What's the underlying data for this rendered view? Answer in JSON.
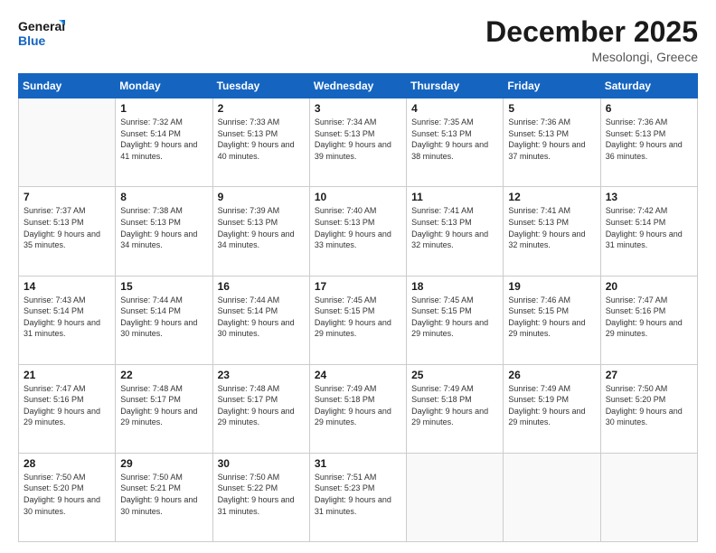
{
  "logo": {
    "line1": "General",
    "line2": "Blue"
  },
  "title": "December 2025",
  "location": "Mesolongi, Greece",
  "weekdays": [
    "Sunday",
    "Monday",
    "Tuesday",
    "Wednesday",
    "Thursday",
    "Friday",
    "Saturday"
  ],
  "weeks": [
    [
      {
        "day": "",
        "sunrise": "",
        "sunset": "",
        "daylight": ""
      },
      {
        "day": "1",
        "sunrise": "Sunrise: 7:32 AM",
        "sunset": "Sunset: 5:14 PM",
        "daylight": "Daylight: 9 hours and 41 minutes."
      },
      {
        "day": "2",
        "sunrise": "Sunrise: 7:33 AM",
        "sunset": "Sunset: 5:13 PM",
        "daylight": "Daylight: 9 hours and 40 minutes."
      },
      {
        "day": "3",
        "sunrise": "Sunrise: 7:34 AM",
        "sunset": "Sunset: 5:13 PM",
        "daylight": "Daylight: 9 hours and 39 minutes."
      },
      {
        "day": "4",
        "sunrise": "Sunrise: 7:35 AM",
        "sunset": "Sunset: 5:13 PM",
        "daylight": "Daylight: 9 hours and 38 minutes."
      },
      {
        "day": "5",
        "sunrise": "Sunrise: 7:36 AM",
        "sunset": "Sunset: 5:13 PM",
        "daylight": "Daylight: 9 hours and 37 minutes."
      },
      {
        "day": "6",
        "sunrise": "Sunrise: 7:36 AM",
        "sunset": "Sunset: 5:13 PM",
        "daylight": "Daylight: 9 hours and 36 minutes."
      }
    ],
    [
      {
        "day": "7",
        "sunrise": "Sunrise: 7:37 AM",
        "sunset": "Sunset: 5:13 PM",
        "daylight": "Daylight: 9 hours and 35 minutes."
      },
      {
        "day": "8",
        "sunrise": "Sunrise: 7:38 AM",
        "sunset": "Sunset: 5:13 PM",
        "daylight": "Daylight: 9 hours and 34 minutes."
      },
      {
        "day": "9",
        "sunrise": "Sunrise: 7:39 AM",
        "sunset": "Sunset: 5:13 PM",
        "daylight": "Daylight: 9 hours and 34 minutes."
      },
      {
        "day": "10",
        "sunrise": "Sunrise: 7:40 AM",
        "sunset": "Sunset: 5:13 PM",
        "daylight": "Daylight: 9 hours and 33 minutes."
      },
      {
        "day": "11",
        "sunrise": "Sunrise: 7:41 AM",
        "sunset": "Sunset: 5:13 PM",
        "daylight": "Daylight: 9 hours and 32 minutes."
      },
      {
        "day": "12",
        "sunrise": "Sunrise: 7:41 AM",
        "sunset": "Sunset: 5:13 PM",
        "daylight": "Daylight: 9 hours and 32 minutes."
      },
      {
        "day": "13",
        "sunrise": "Sunrise: 7:42 AM",
        "sunset": "Sunset: 5:14 PM",
        "daylight": "Daylight: 9 hours and 31 minutes."
      }
    ],
    [
      {
        "day": "14",
        "sunrise": "Sunrise: 7:43 AM",
        "sunset": "Sunset: 5:14 PM",
        "daylight": "Daylight: 9 hours and 31 minutes."
      },
      {
        "day": "15",
        "sunrise": "Sunrise: 7:44 AM",
        "sunset": "Sunset: 5:14 PM",
        "daylight": "Daylight: 9 hours and 30 minutes."
      },
      {
        "day": "16",
        "sunrise": "Sunrise: 7:44 AM",
        "sunset": "Sunset: 5:14 PM",
        "daylight": "Daylight: 9 hours and 30 minutes."
      },
      {
        "day": "17",
        "sunrise": "Sunrise: 7:45 AM",
        "sunset": "Sunset: 5:15 PM",
        "daylight": "Daylight: 9 hours and 29 minutes."
      },
      {
        "day": "18",
        "sunrise": "Sunrise: 7:45 AM",
        "sunset": "Sunset: 5:15 PM",
        "daylight": "Daylight: 9 hours and 29 minutes."
      },
      {
        "day": "19",
        "sunrise": "Sunrise: 7:46 AM",
        "sunset": "Sunset: 5:15 PM",
        "daylight": "Daylight: 9 hours and 29 minutes."
      },
      {
        "day": "20",
        "sunrise": "Sunrise: 7:47 AM",
        "sunset": "Sunset: 5:16 PM",
        "daylight": "Daylight: 9 hours and 29 minutes."
      }
    ],
    [
      {
        "day": "21",
        "sunrise": "Sunrise: 7:47 AM",
        "sunset": "Sunset: 5:16 PM",
        "daylight": "Daylight: 9 hours and 29 minutes."
      },
      {
        "day": "22",
        "sunrise": "Sunrise: 7:48 AM",
        "sunset": "Sunset: 5:17 PM",
        "daylight": "Daylight: 9 hours and 29 minutes."
      },
      {
        "day": "23",
        "sunrise": "Sunrise: 7:48 AM",
        "sunset": "Sunset: 5:17 PM",
        "daylight": "Daylight: 9 hours and 29 minutes."
      },
      {
        "day": "24",
        "sunrise": "Sunrise: 7:49 AM",
        "sunset": "Sunset: 5:18 PM",
        "daylight": "Daylight: 9 hours and 29 minutes."
      },
      {
        "day": "25",
        "sunrise": "Sunrise: 7:49 AM",
        "sunset": "Sunset: 5:18 PM",
        "daylight": "Daylight: 9 hours and 29 minutes."
      },
      {
        "day": "26",
        "sunrise": "Sunrise: 7:49 AM",
        "sunset": "Sunset: 5:19 PM",
        "daylight": "Daylight: 9 hours and 29 minutes."
      },
      {
        "day": "27",
        "sunrise": "Sunrise: 7:50 AM",
        "sunset": "Sunset: 5:20 PM",
        "daylight": "Daylight: 9 hours and 30 minutes."
      }
    ],
    [
      {
        "day": "28",
        "sunrise": "Sunrise: 7:50 AM",
        "sunset": "Sunset: 5:20 PM",
        "daylight": "Daylight: 9 hours and 30 minutes."
      },
      {
        "day": "29",
        "sunrise": "Sunrise: 7:50 AM",
        "sunset": "Sunset: 5:21 PM",
        "daylight": "Daylight: 9 hours and 30 minutes."
      },
      {
        "day": "30",
        "sunrise": "Sunrise: 7:50 AM",
        "sunset": "Sunset: 5:22 PM",
        "daylight": "Daylight: 9 hours and 31 minutes."
      },
      {
        "day": "31",
        "sunrise": "Sunrise: 7:51 AM",
        "sunset": "Sunset: 5:23 PM",
        "daylight": "Daylight: 9 hours and 31 minutes."
      },
      {
        "day": "",
        "sunrise": "",
        "sunset": "",
        "daylight": ""
      },
      {
        "day": "",
        "sunrise": "",
        "sunset": "",
        "daylight": ""
      },
      {
        "day": "",
        "sunrise": "",
        "sunset": "",
        "daylight": ""
      }
    ]
  ]
}
